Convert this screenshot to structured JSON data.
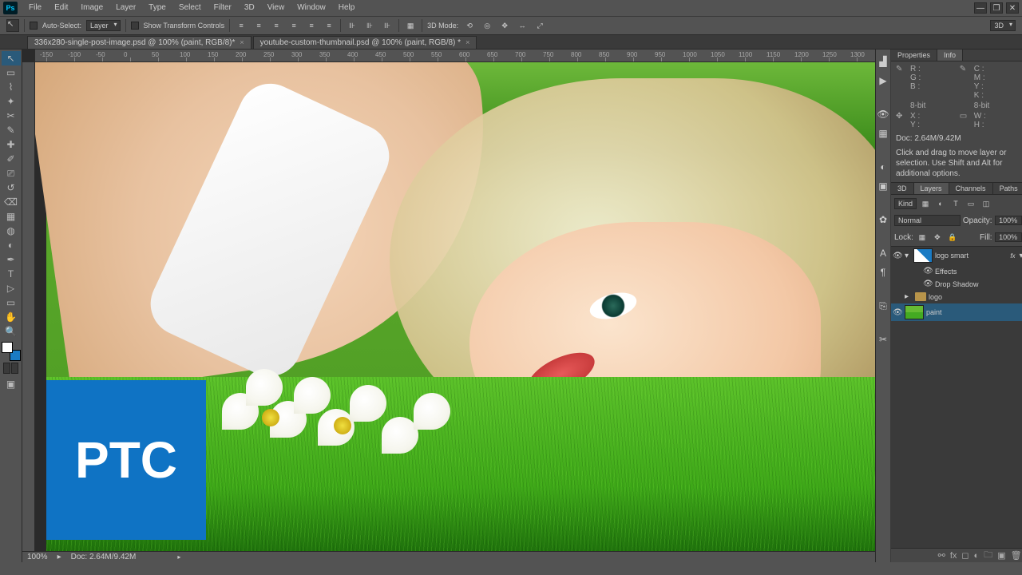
{
  "app": {
    "logo": "Ps"
  },
  "menu": [
    "File",
    "Edit",
    "Image",
    "Layer",
    "Type",
    "Select",
    "Filter",
    "3D",
    "View",
    "Window",
    "Help"
  ],
  "window_controls": {
    "min": "—",
    "restore": "❐",
    "close": "✕"
  },
  "options": {
    "auto_select_label": "Auto-Select:",
    "auto_select_target": "Layer",
    "show_transform": "Show Transform Controls",
    "mode3d_label": "3D Mode:"
  },
  "workspace_switcher": "3D",
  "tabs": [
    {
      "title": "336x280-single-post-image.psd @ 100% (paint, RGB/8)*",
      "active": false
    },
    {
      "title": "youtube-custom-thumbnail.psd @ 100% (paint, RGB/8) *",
      "active": true
    }
  ],
  "ruler_marks": [
    "-150",
    "-100",
    "-50",
    "0",
    "50",
    "100",
    "150",
    "200",
    "250",
    "300",
    "350",
    "400",
    "450",
    "500",
    "550",
    "600",
    "650",
    "700",
    "750",
    "800",
    "850",
    "900",
    "950",
    "1000",
    "1050",
    "1100",
    "1150",
    "1200",
    "1250",
    "1300"
  ],
  "ptc_logo_text": "PTC",
  "status": {
    "zoom": "100%",
    "doc": "Doc: 2.64M/9.42M"
  },
  "panels": {
    "properties_tab": "Properties",
    "info_tab": "Info",
    "info": {
      "R": "R :",
      "G": "G :",
      "B": "B :",
      "C": "C :",
      "M": "M :",
      "Y": "Y :",
      "K": "K :",
      "bit_left": "8-bit",
      "bit_right": "8-bit",
      "X": "X :",
      "W": "W :",
      "H": "H :",
      "doc": "Doc: 2.64M/9.42M",
      "hint": "Click and drag to move layer or selection. Use Shift and Alt for additional options."
    },
    "layer_tabs": [
      "3D",
      "Layers",
      "Channels",
      "Paths"
    ],
    "layer_tabs_sel": "Layers",
    "kind": "Kind",
    "blend": "Normal",
    "opacity_label": "Opacity:",
    "opacity": "100%",
    "lock_label": "Lock:",
    "fill_label": "Fill:",
    "fill": "100%",
    "layers": [
      {
        "name": "logo smart",
        "fx": true,
        "smart": true
      },
      {
        "name": "Effects",
        "effect": true
      },
      {
        "name": "Drop Shadow",
        "effect": true
      },
      {
        "name": "logo",
        "group": true
      },
      {
        "name": "paint",
        "selected": true,
        "paint": true
      }
    ]
  },
  "tools": [
    "↖",
    "▭",
    "◫",
    "⊡",
    "✂",
    "✎",
    "↗",
    "✚",
    "▦",
    "◐",
    "✐",
    "⎚",
    "⌫",
    "◍",
    "▲",
    "◯",
    "〰",
    "✋",
    "✥",
    "T",
    "▷",
    "▭",
    "✿",
    "◫",
    "🔍"
  ],
  "icon_strip": [
    "📊",
    "▶",
    "👁",
    "🗺",
    "↔",
    "⬚",
    "⊕",
    "A",
    "📏",
    "◻",
    "⧉"
  ]
}
